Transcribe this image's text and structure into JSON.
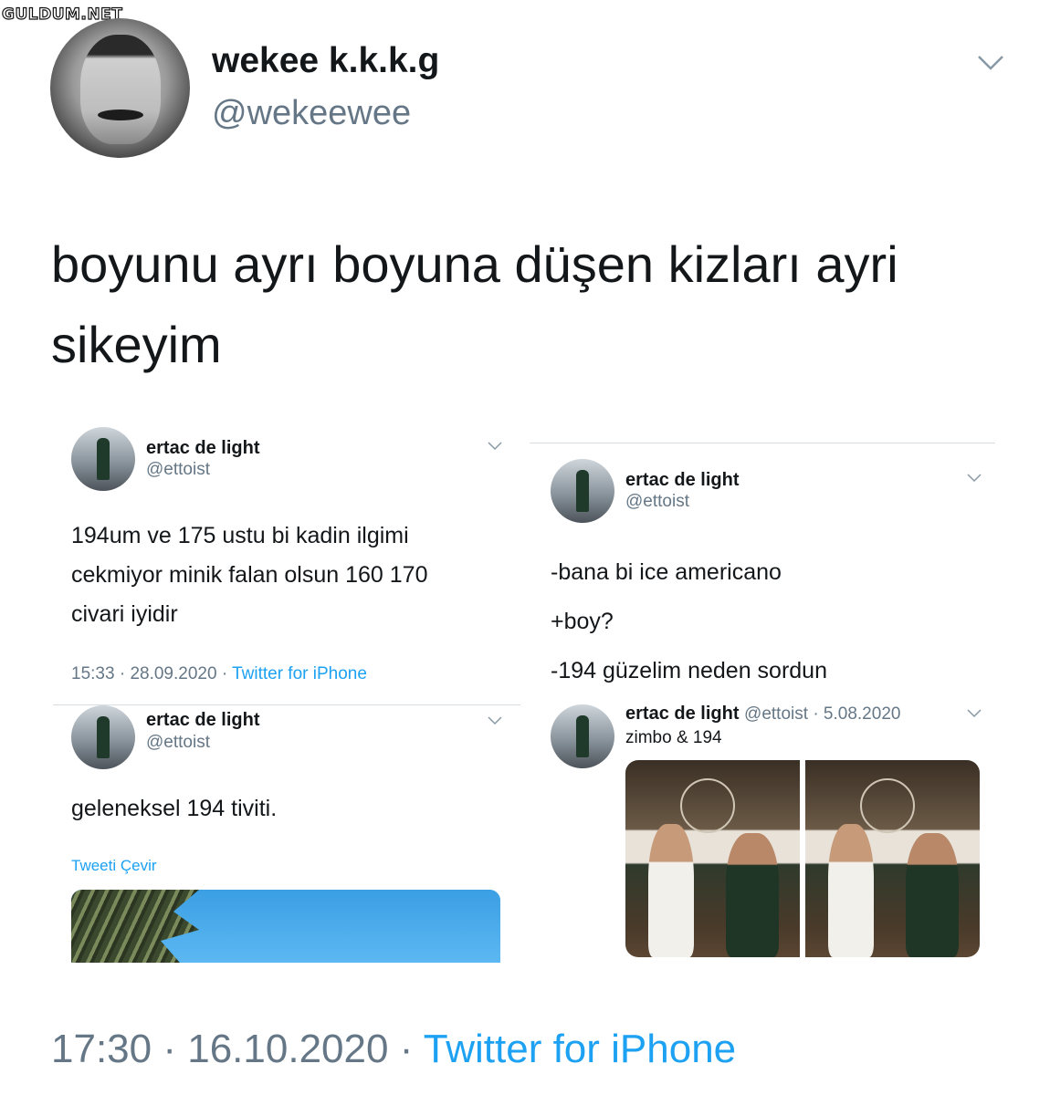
{
  "watermark": "GULDUM.NET",
  "tweet": {
    "author_name": "wekee k.k.k.g",
    "author_handle": "@wekeewee",
    "text_line1": "boyunu ayrı boyuna düşen kizları ayri",
    "text_line2": "sikeyim",
    "time": "17:30",
    "date": "16.10.2020",
    "separator": "·",
    "source": "Twitter for iPhone"
  },
  "embedded": [
    {
      "name": "ertac de light",
      "handle": "@ettoist",
      "text_lines": [
        "194um ve 175 ustu bi kadin ilgimi",
        "cekmiyor minik falan olsun 160 170",
        "civari iyidir"
      ],
      "time": "15:33",
      "date": "28.09.2020",
      "source": "Twitter for iPhone"
    },
    {
      "name": "ertac de light",
      "handle": "@ettoist",
      "text_lines": [
        "-bana bi ice americano",
        "+boy?",
        "-194 güzelim neden sordun"
      ]
    },
    {
      "name": "ertac de light",
      "handle": "@ettoist",
      "text": "geleneksel 194 tiviti.",
      "translate": "Tweeti Çevir"
    },
    {
      "name": "ertac de light",
      "handle": "@ettoist",
      "date": "5.08.2020",
      "text": "zimbo & 194"
    }
  ],
  "colors": {
    "link": "#1da1f2",
    "secondary": "#657786",
    "text": "#14171a"
  },
  "icons": [
    "chevron-down-icon"
  ]
}
